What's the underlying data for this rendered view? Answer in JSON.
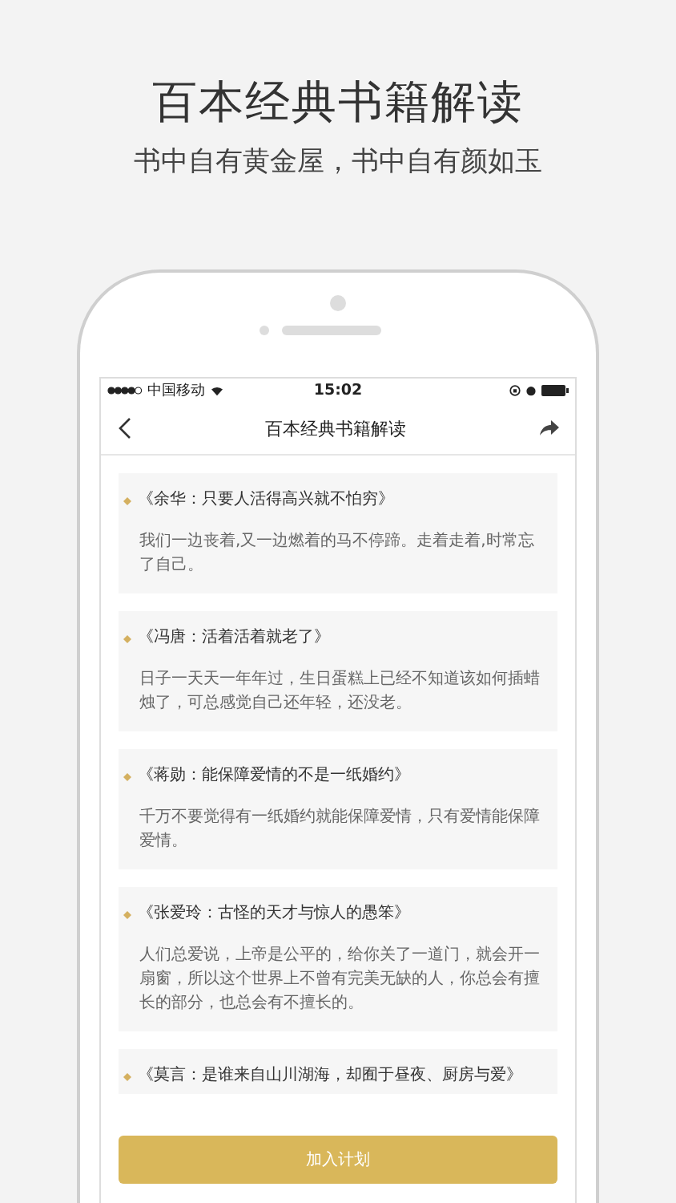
{
  "header": {
    "title": "百本经典书籍解读",
    "subtitle": "书中自有黄金屋，书中自有颜如玉"
  },
  "status_bar": {
    "carrier": "中国移动",
    "time": "15:02"
  },
  "nav": {
    "title": "百本经典书籍解读"
  },
  "books": [
    {
      "title": "《余华：只要人活得高兴就不怕穷》",
      "excerpt": "我们一边丧着,又一边燃着的马不停蹄。走着走着,时常忘了自己。"
    },
    {
      "title": "《冯唐：活着活着就老了》",
      "excerpt": "日子一天天一年年过，生日蛋糕上已经不知道该如何插蜡烛了，可总感觉自己还年轻，还没老。"
    },
    {
      "title": "《蒋勋：能保障爱情的不是一纸婚约》",
      "excerpt": "千万不要觉得有一纸婚约就能保障爱情，只有爱情能保障爱情。"
    },
    {
      "title": "《张爱玲：古怪的天才与惊人的愚笨》",
      "excerpt": "人们总爱说，上帝是公平的，给你关了一道门，就会开一扇窗，所以这个世界上不曾有完美无缺的人，你总会有擅长的部分，也总会有不擅长的。"
    },
    {
      "title": "《莫言：是谁来自山川湖海，却囿于昼夜、厨房与爱》"
    }
  ],
  "action_button": "加入计划"
}
